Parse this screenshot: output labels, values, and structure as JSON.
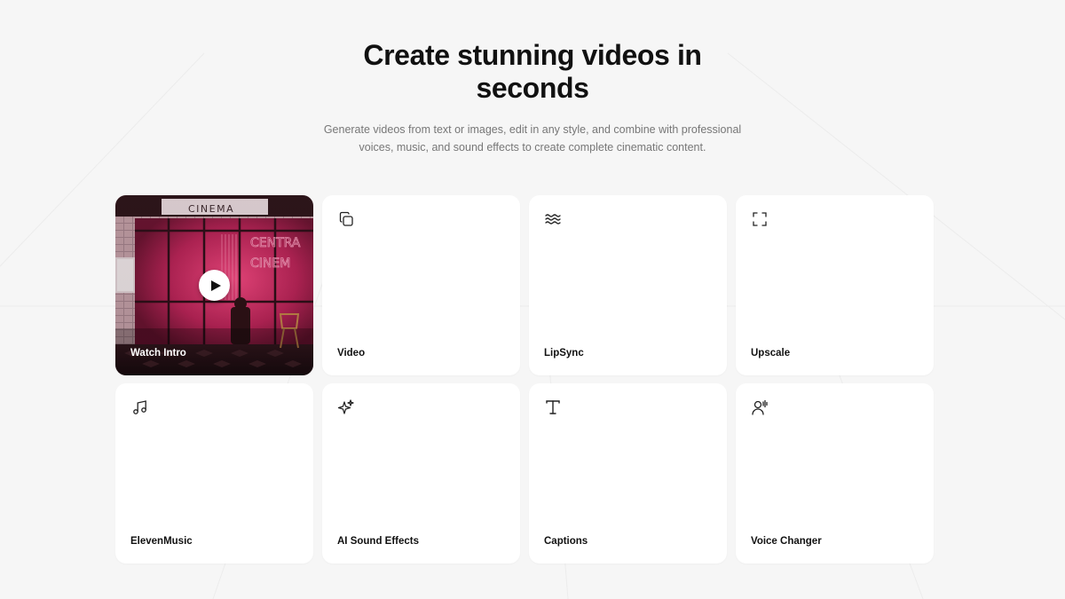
{
  "hero": {
    "title": "Create stunning videos in seconds",
    "subtitle": "Generate videos from text or images, edit in any style, and combine with professional voices, music, and sound effects to create complete cinematic content."
  },
  "intro_card": {
    "label": "Watch Intro",
    "sign_text": "CINEMA",
    "neon_line1": "CENTRA",
    "neon_line2": "CINEM"
  },
  "tools": [
    {
      "label": "Video",
      "icon": "copy-icon"
    },
    {
      "label": "LipSync",
      "icon": "waves-icon"
    },
    {
      "label": "Upscale",
      "icon": "expand-icon"
    },
    {
      "label": "ElevenMusic",
      "icon": "music-note-icon"
    },
    {
      "label": "AI Sound Effects",
      "icon": "sparkles-icon"
    },
    {
      "label": "Captions",
      "icon": "text-icon"
    },
    {
      "label": "Voice Changer",
      "icon": "voice-user-icon"
    }
  ],
  "colors": {
    "background": "#f6f6f6",
    "card": "#ffffff",
    "text": "#111111",
    "muted": "#777777",
    "neon": "#ff3d7f"
  }
}
